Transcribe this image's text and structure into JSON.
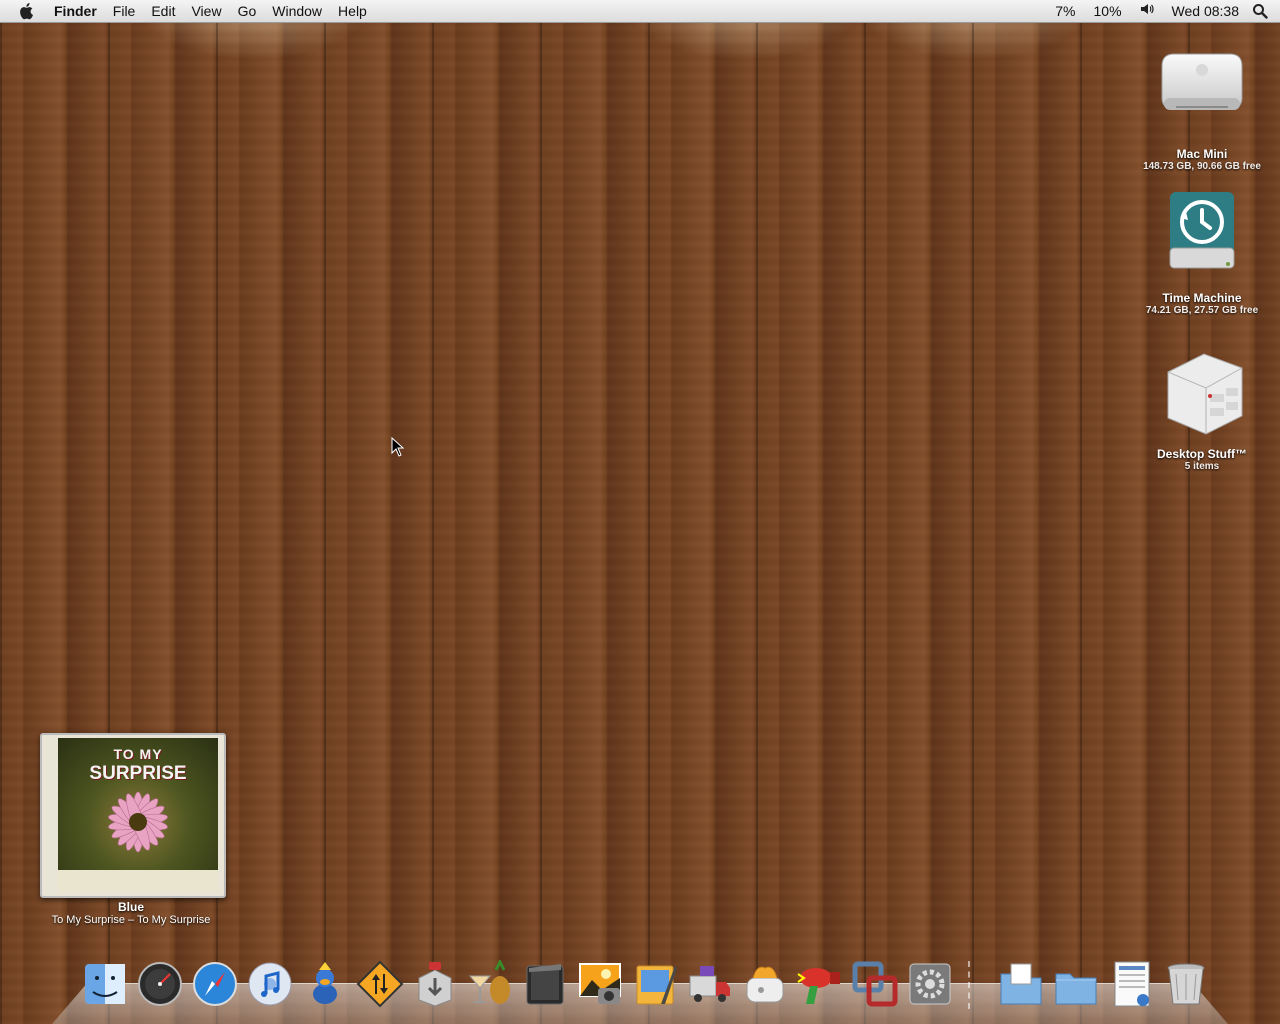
{
  "menubar": {
    "apple_icon": "apple-icon",
    "app_name": "Finder",
    "menus": [
      "File",
      "Edit",
      "View",
      "Go",
      "Window",
      "Help"
    ],
    "status_cpu1": "7%",
    "status_cpu2": "10%",
    "volume_icon": "volume-icon",
    "clock": "Wed 08:38",
    "spotlight_icon": "spotlight-icon"
  },
  "desktop": {
    "icons": [
      {
        "name": "Mac Mini",
        "info": "148.73 GB, 90.66 GB free",
        "icon": "mac-mini-icon"
      },
      {
        "name": "Time Machine",
        "info": "74.21 GB, 27.57 GB free",
        "icon": "time-machine-drive-icon"
      },
      {
        "name": "Desktop Stuff™",
        "info": "5 items",
        "icon": "desktop-stuff-icon"
      }
    ]
  },
  "now_playing": {
    "cover_title_line1": "TO MY",
    "cover_title_line2": "SURPRISE",
    "song": "Blue",
    "album": "To My Surprise – To My Surprise"
  },
  "dock": {
    "apps": [
      "finder-icon",
      "dashboard-icon",
      "safari-icon",
      "itunes-icon",
      "adium-icon",
      "transmit-icon",
      "installer-icon",
      "cocktail-icon",
      "quicktime-icon",
      "iphoto-icon",
      "pages-icon",
      "transmission-icon",
      "toaster-icon",
      "hair-dryer-icon",
      "vmware-icon",
      "system-preferences-icon"
    ],
    "stacks": [
      "documents-stack-icon",
      "downloads-folder-icon",
      "applications-folder-icon",
      "web-document-icon",
      "trash-icon"
    ]
  },
  "colors": {
    "menubar": "#e6e6e6",
    "wood": "#7b4726"
  }
}
